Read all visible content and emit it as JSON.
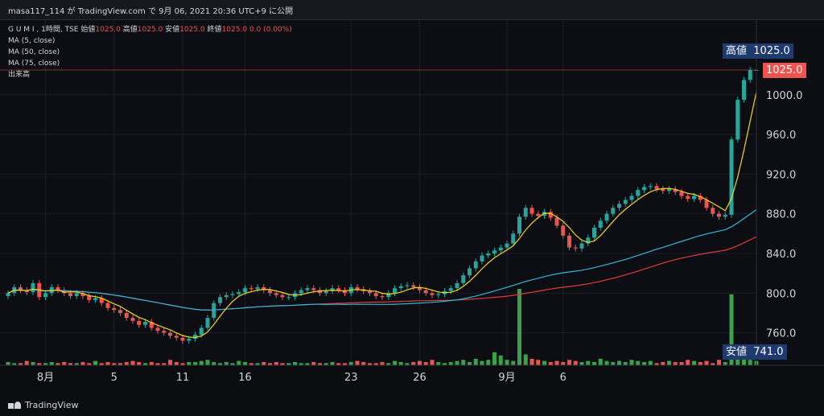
{
  "header": {
    "text": "masa117_114 が TradingView.com で 9月 06, 2021 20:36 UTC+9 に公開"
  },
  "legend": {
    "symbol": "G U M I , 1時間, TSE",
    "open_label": "始値",
    "open": "1025.0",
    "high_label": "高値",
    "high": "1025.0",
    "low_label": "安値",
    "low": "1025.0",
    "close_label": "終値",
    "close": "1025.0",
    "change": "0.0 (0.00%)",
    "ma5": "MA (5, close)",
    "ma50": "MA (50, close)",
    "ma75": "MA (75, close)",
    "volume": "出来高"
  },
  "tags": {
    "high_label": "高値",
    "high_value": "1025.0",
    "last_value": "1025.0",
    "low_label": "安値",
    "low_value": "741.0"
  },
  "brand": "TradingView",
  "chart_data": {
    "type": "candlestick",
    "y_ticks": [
      "1000.0",
      "960.0",
      "920.0",
      "880.0",
      "840.0",
      "800.0",
      "760.0"
    ],
    "y_tick_values": [
      1000,
      960,
      920,
      880,
      840,
      800,
      760
    ],
    "ylim": [
      741,
      1025
    ],
    "x_labels": [
      "8月",
      "5",
      "11",
      "16",
      "23",
      "26",
      "9月",
      "6"
    ],
    "x_label_bar_index": [
      6,
      17,
      28,
      38,
      55,
      66,
      80,
      89
    ],
    "colors": {
      "up": "#26a69a",
      "down": "#ef5350",
      "ma5": "#f5d524",
      "ma50": "#2fb8d8",
      "ma75": "#e03b3b",
      "vol_up": "#3aa24a",
      "vol_down": "#ef5350"
    },
    "closes": [
      800,
      806,
      803,
      801,
      810,
      796,
      800,
      806,
      803,
      800,
      797,
      800,
      797,
      793,
      795,
      790,
      785,
      783,
      780,
      775,
      772,
      768,
      771,
      765,
      762,
      760,
      757,
      755,
      752,
      754,
      758,
      765,
      775,
      790,
      796,
      798,
      799,
      801,
      805,
      804,
      806,
      803,
      800,
      798,
      796,
      796,
      800,
      803,
      805,
      803,
      800,
      802,
      805,
      803,
      800,
      806,
      804,
      802,
      800,
      797,
      796,
      800,
      805,
      807,
      808,
      806,
      803,
      800,
      798,
      799,
      802,
      805,
      810,
      818,
      825,
      832,
      838,
      840,
      843,
      846,
      850,
      860,
      877,
      886,
      880,
      878,
      882,
      876,
      868,
      858,
      846,
      845,
      850,
      856,
      866,
      873,
      880,
      886,
      890,
      894,
      898,
      904,
      907,
      908,
      905,
      903,
      905,
      902,
      898,
      895,
      898,
      894,
      886,
      880,
      877,
      879,
      955,
      995,
      1015,
      1025,
      1025
    ],
    "volume": [
      3,
      2,
      2,
      4,
      3,
      2,
      2,
      3,
      2,
      3,
      2,
      2,
      3,
      2,
      4,
      2,
      3,
      2,
      2,
      3,
      4,
      3,
      2,
      3,
      2,
      2,
      5,
      3,
      2,
      3,
      3,
      4,
      5,
      3,
      2,
      3,
      2,
      4,
      3,
      2,
      2,
      3,
      2,
      3,
      2,
      2,
      3,
      2,
      2,
      3,
      2,
      2,
      3,
      2,
      2,
      3,
      4,
      3,
      2,
      2,
      3,
      2,
      4,
      3,
      2,
      3,
      4,
      3,
      5,
      3,
      2,
      3,
      4,
      5,
      3,
      6,
      4,
      5,
      12,
      9,
      5,
      4,
      70,
      10,
      6,
      5,
      4,
      3,
      4,
      3,
      5,
      4,
      3,
      4,
      3,
      6,
      4,
      3,
      4,
      3,
      5,
      4,
      3,
      4,
      2,
      3,
      4,
      3,
      3,
      5,
      4,
      3,
      4,
      2,
      5,
      3,
      65,
      10,
      18,
      5,
      4
    ]
  }
}
